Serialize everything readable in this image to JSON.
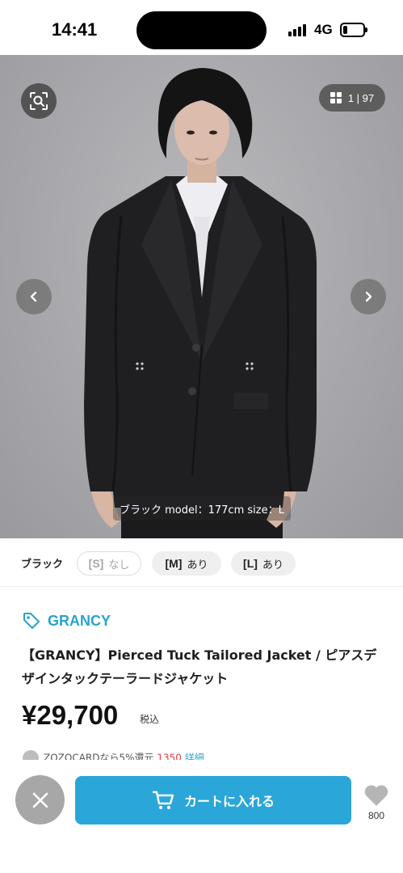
{
  "status_bar": {
    "time": "14:41",
    "network": "4G",
    "battery_level": 0.2
  },
  "gallery": {
    "current": "1",
    "total": "97",
    "counter_text": "1 | 97",
    "caption": "ブラック model：177cm size：L"
  },
  "sizes": {
    "color_name": "ブラック",
    "options": [
      {
        "size": "[S]",
        "stock": "なし"
      },
      {
        "size": "[M]",
        "stock": "あり"
      },
      {
        "size": "[L]",
        "stock": "あり"
      }
    ]
  },
  "product": {
    "brand": "GRANCY",
    "title": "【GRANCY】Pierced Tuck Tailored Jacket / ピアスデザインタックテーラードジャケット",
    "price": "¥29,700",
    "tax_label": "税込",
    "promo": {
      "text": "ZOZOCARDなら5%還元",
      "points": "1350",
      "more": "詳細"
    }
  },
  "actions": {
    "cart_label": "カートに入れる",
    "favorite_count": "800"
  },
  "colors": {
    "accent": "#2aa6d9",
    "brand": "#29a3cf",
    "close": "#a7a7a7"
  }
}
